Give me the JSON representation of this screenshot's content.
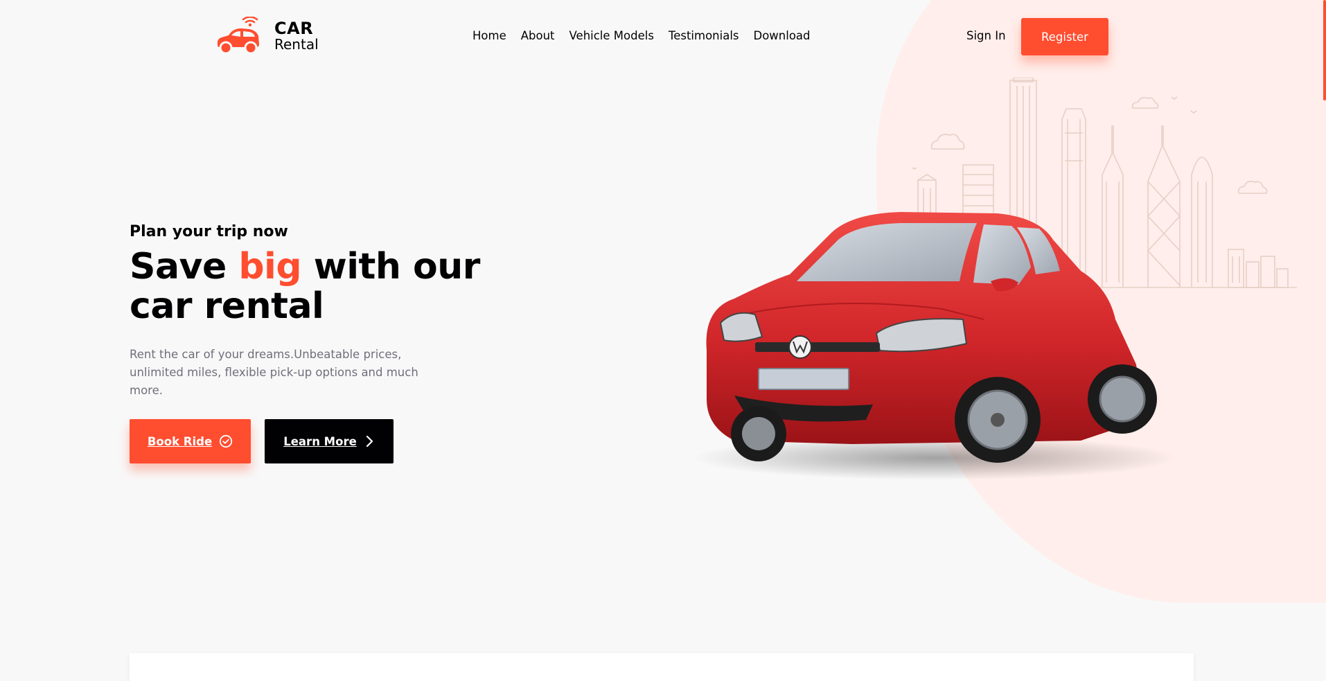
{
  "brand": {
    "title": "CAR",
    "subtitle": "Rental",
    "accent_color": "#ff4d30",
    "icon": "car-wifi-icon"
  },
  "nav": {
    "links": [
      "Home",
      "About",
      "Vehicle Models",
      "Testimonials",
      "Download"
    ],
    "sign_in": "Sign In",
    "register": "Register"
  },
  "hero": {
    "kicker": "Plan your trip now",
    "headline_part1": "Save ",
    "headline_accent": "big",
    "headline_part2": " with our car rental",
    "description": "Rent the car of your dreams.Unbeatable prices, unlimited miles, flexible pick-up options and much more.",
    "book_button": "Book Ride",
    "book_icon": "check-circle-icon",
    "learn_button": "Learn More",
    "learn_icon": "chevron-right-icon"
  },
  "colors": {
    "accent": "#ff4d30",
    "dark": "#010103",
    "muted_text": "#706f7b",
    "blob": "#ffeeeb",
    "background": "#f8f8f8"
  }
}
